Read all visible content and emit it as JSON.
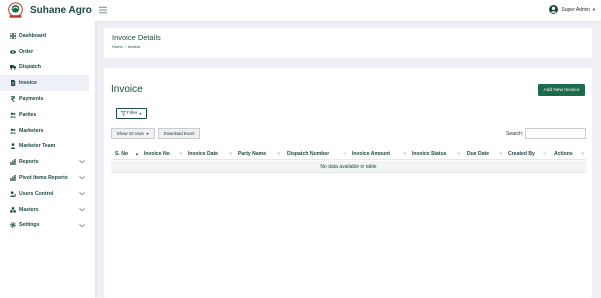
{
  "brand": {
    "name": "Suhane Agro",
    "logo_text": "SUHANE AGRO"
  },
  "topbar": {
    "user_name": "Super Admin"
  },
  "sidebar": {
    "items": [
      {
        "label": "Dashboard",
        "icon": "grid-icon",
        "expandable": false
      },
      {
        "label": "Order",
        "icon": "eye-icon",
        "expandable": false
      },
      {
        "label": "Dispatch",
        "icon": "truck-icon",
        "expandable": false
      },
      {
        "label": "Invoice",
        "icon": "file-icon",
        "expandable": false,
        "active": true
      },
      {
        "label": "Payments",
        "icon": "rupee-icon",
        "expandable": false
      },
      {
        "label": "Parties",
        "icon": "users-icon",
        "expandable": false
      },
      {
        "label": "Marketers",
        "icon": "users-icon",
        "expandable": false
      },
      {
        "label": "Marketer Team",
        "icon": "team-icon",
        "expandable": false
      },
      {
        "label": "Reports",
        "icon": "chart-icon",
        "expandable": true
      },
      {
        "label": "Pivot Items Reports",
        "icon": "chart-icon",
        "expandable": true
      },
      {
        "label": "Users Control",
        "icon": "user-cog-icon",
        "expandable": true
      },
      {
        "label": "Masters",
        "icon": "cubes-icon",
        "expandable": true
      },
      {
        "label": "Settings",
        "icon": "gear-icon",
        "expandable": true
      }
    ]
  },
  "header": {
    "title": "Invoice Details",
    "breadcrumb": [
      "Home",
      "Invoice"
    ]
  },
  "main": {
    "title": "Invoice",
    "add_button": "Add New Invoice",
    "filter_button": "Filter",
    "show_rows": "Show 10 rows",
    "download_button": "Download Excel",
    "search_label": "Search:",
    "search_value": "",
    "empty_message": "No data available in table"
  },
  "table": {
    "columns": [
      "S. No",
      "Invoice No",
      "Invoice Date",
      "Party Name",
      "Dispatch Number",
      "Invoice Amount",
      "Invoice Status",
      "Due Date",
      "Created By",
      "Actions"
    ]
  },
  "colors": {
    "accent": "#1d6b4c",
    "text": "#1d4a45",
    "background": "#eef0f5"
  }
}
